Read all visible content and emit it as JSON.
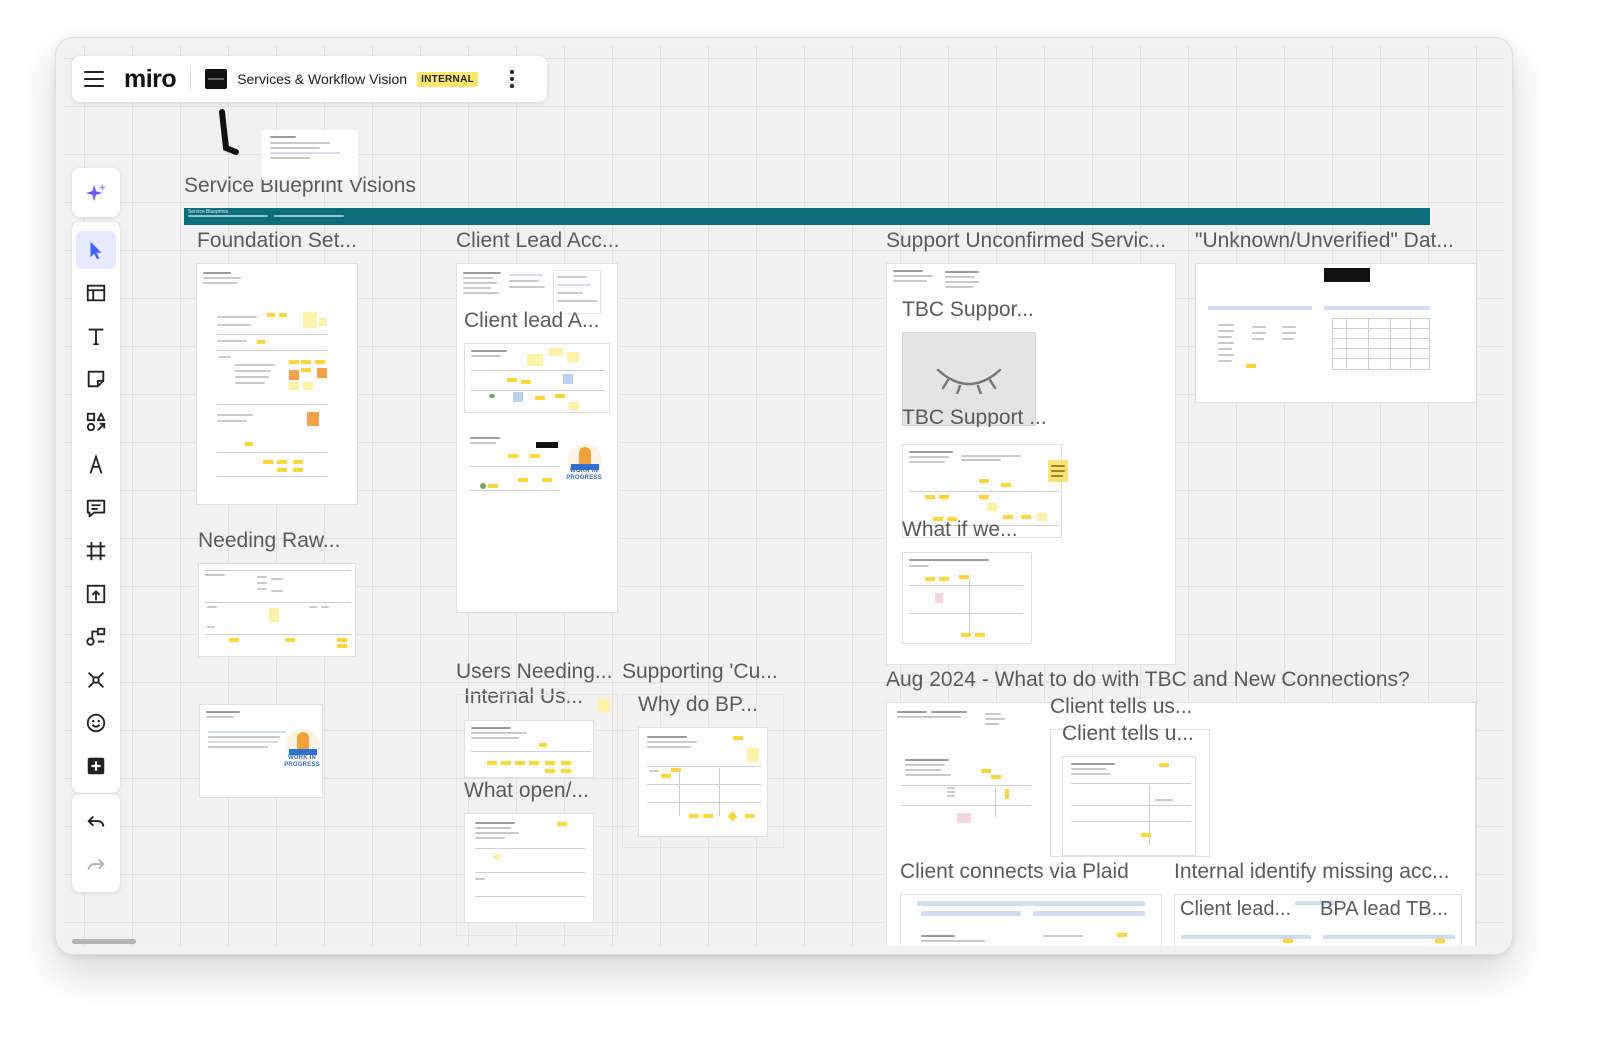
{
  "app": {
    "logo_text": "miro",
    "board_title": "Services & Workflow Vision",
    "board_badge": "INTERNAL"
  },
  "toolbar": {
    "tools": [
      {
        "name": "ai-sparkle-icon"
      },
      {
        "name": "select-cursor-icon",
        "active": true
      },
      {
        "name": "templates-icon"
      },
      {
        "name": "text-icon"
      },
      {
        "name": "sticky-note-icon"
      },
      {
        "name": "shapes-icon"
      },
      {
        "name": "pen-icon"
      },
      {
        "name": "comment-icon"
      },
      {
        "name": "frame-icon"
      },
      {
        "name": "upload-icon"
      },
      {
        "name": "diagram-icon"
      },
      {
        "name": "mind-map-icon"
      },
      {
        "name": "emoji-reaction-icon"
      },
      {
        "name": "more-apps-icon"
      }
    ],
    "history": [
      {
        "name": "undo-icon"
      },
      {
        "name": "redo-icon"
      }
    ]
  },
  "canvas": {
    "section_title": "Service Blueprint Visions",
    "banner_text": "Service Blueprints",
    "frames": {
      "foundation": "Foundation Set...",
      "client_lead_acc": "Client Lead Acc...",
      "client_lead_a": "Client lead A...",
      "support_unconfirmed": "Support Unconfirmed Servic...",
      "unknown_unverified": "\"Unknown/Unverified\" Dat...",
      "tbc_suppor": "TBC Suppor...",
      "tbc_support_2": "TBC Support ...",
      "what_if_we": "What if we...",
      "needing_raw": "Needing Raw...",
      "users_needing": "Users Needing...",
      "internal_us": "Internal Us...",
      "what_open": "What open/...",
      "supporting_cu": "Supporting 'Cu...",
      "why_do_bp": "Why do BP...",
      "aug_2024": "Aug 2024 - What to do with TBC and New Connections?",
      "client_tells_us": "Client tells us...",
      "client_tells_u": "Client tells u...",
      "client_connects_plaid": "Client connects via Plaid",
      "internal_identify": "Internal identify missing acc...",
      "client_lead_2": "Client lead...",
      "bpa_lead": "BPA lead TB..."
    },
    "wip_label": "WORK IN PROGRESS"
  }
}
